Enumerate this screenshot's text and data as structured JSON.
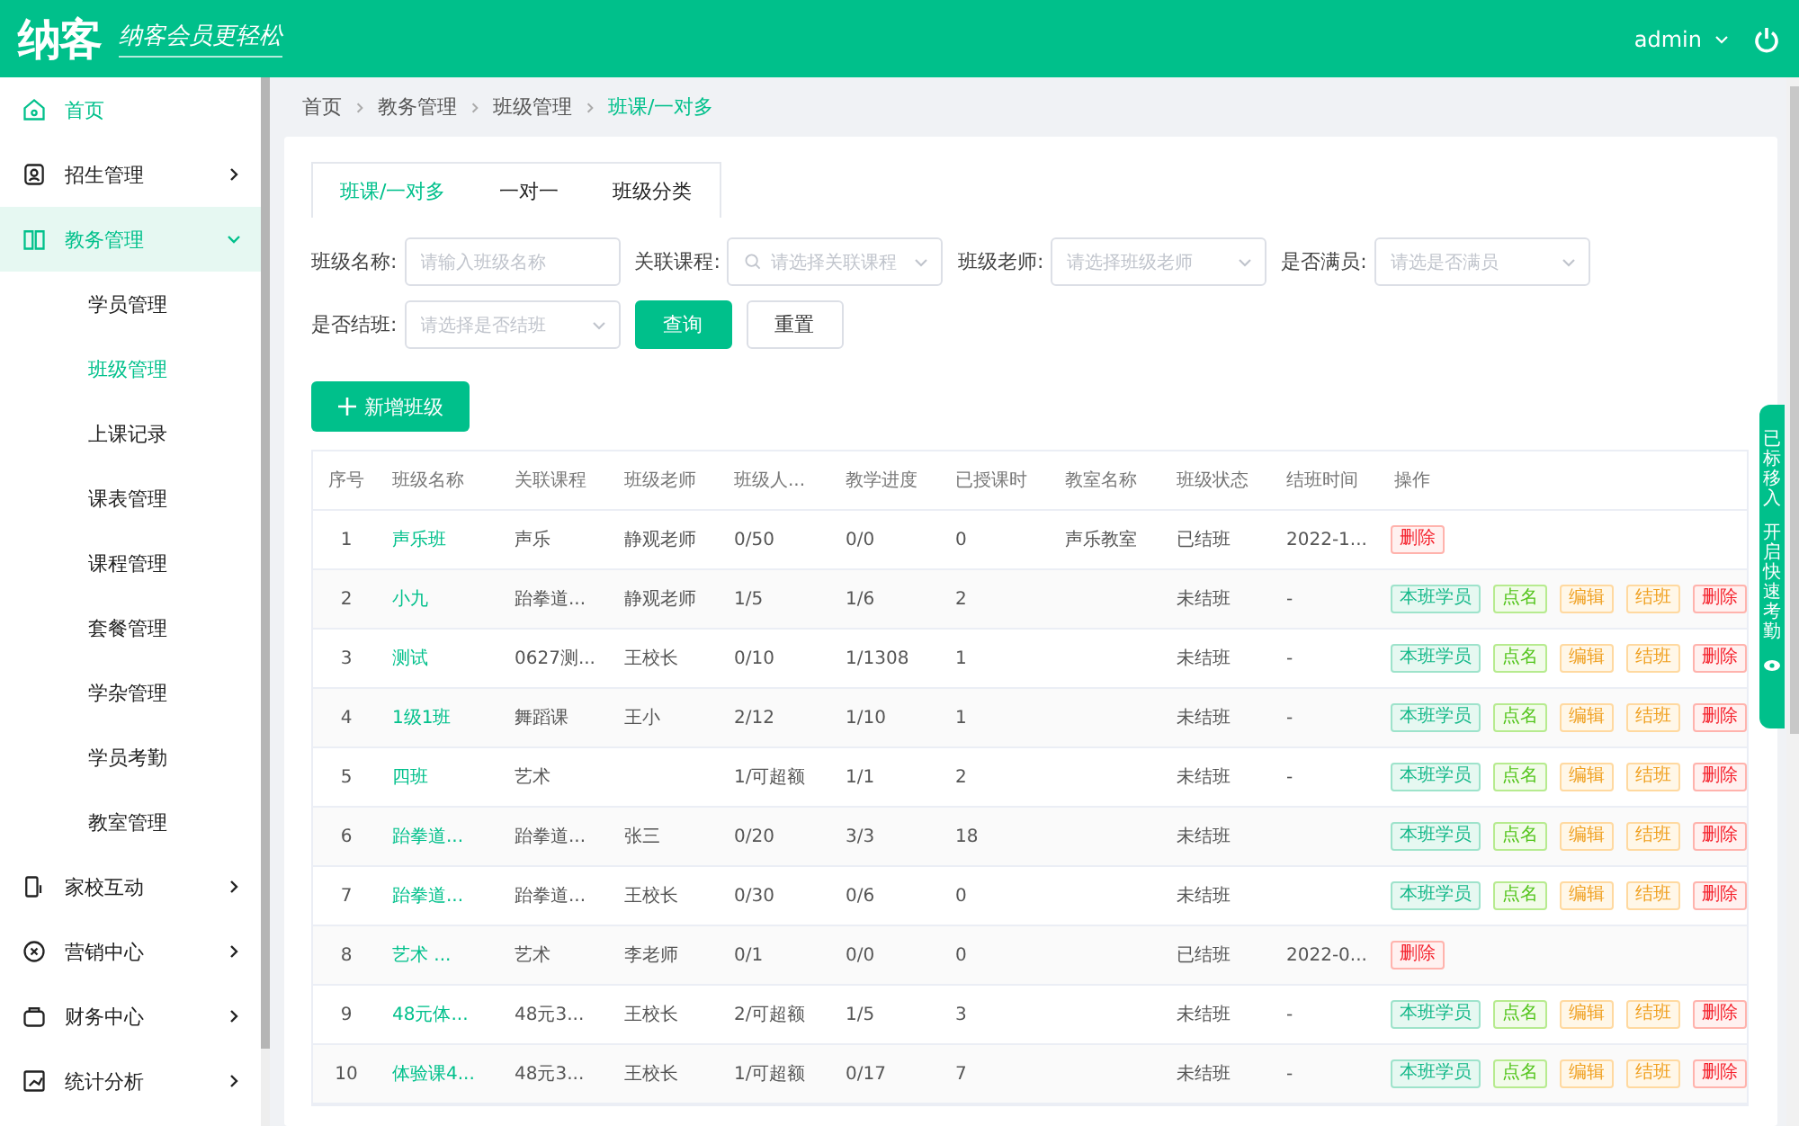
{
  "header": {
    "logo": "纳客",
    "slogan": "纳客会员更轻松",
    "user": "admin"
  },
  "sidebar": {
    "items": [
      {
        "label": "首页",
        "selected": true
      },
      {
        "label": "招生管理",
        "selected": false,
        "expanded": false
      },
      {
        "label": "教务管理",
        "selected": true,
        "expanded": true,
        "children": [
          {
            "label": "学员管理",
            "selected": false
          },
          {
            "label": "班级管理",
            "selected": true
          },
          {
            "label": "上课记录",
            "selected": false
          },
          {
            "label": "课表管理",
            "selected": false
          },
          {
            "label": "课程管理",
            "selected": false
          },
          {
            "label": "套餐管理",
            "selected": false
          },
          {
            "label": "学杂管理",
            "selected": false
          },
          {
            "label": "学员考勤",
            "selected": false
          },
          {
            "label": "教室管理",
            "selected": false
          }
        ]
      },
      {
        "label": "家校互动",
        "selected": false,
        "expanded": false
      },
      {
        "label": "营销中心",
        "selected": false,
        "expanded": false
      },
      {
        "label": "财务中心",
        "selected": false,
        "expanded": false
      },
      {
        "label": "统计分析",
        "selected": false,
        "expanded": false
      }
    ]
  },
  "breadcrumb": [
    {
      "label": "首页",
      "current": false
    },
    {
      "label": "教务管理",
      "current": false
    },
    {
      "label": "班级管理",
      "current": false
    },
    {
      "label": "班课/一对多",
      "current": true
    }
  ],
  "tabs": [
    {
      "label": "班课/一对多",
      "selected": true
    },
    {
      "label": "一对一",
      "selected": false
    },
    {
      "label": "班级分类",
      "selected": false
    }
  ],
  "filters": [
    {
      "label": "班级名称:",
      "placeholder": "请输入班级名称",
      "kind": "input"
    },
    {
      "label": "关联课程:",
      "placeholder": "请选择关联课程",
      "kind": "search-select"
    },
    {
      "label": "班级老师:",
      "placeholder": "请选择班级老师",
      "kind": "select"
    },
    {
      "label": "是否满员:",
      "placeholder": "请选是否满员",
      "kind": "select"
    },
    {
      "label": "是否结班:",
      "placeholder": "请选择是否结班",
      "kind": "select"
    }
  ],
  "query_button": "查询",
  "reset_button": "重置",
  "add_button": "新增班级",
  "table": {
    "columns": [
      {
        "label": "序号",
        "kind": "index"
      },
      {
        "label": "班级名称",
        "kind": "link"
      },
      {
        "label": "关联课程",
        "kind": "text"
      },
      {
        "label": "班级老师",
        "kind": "text"
      },
      {
        "label": "班级人...",
        "kind": "text"
      },
      {
        "label": "教学进度",
        "kind": "text"
      },
      {
        "label": "已授课时",
        "kind": "text"
      },
      {
        "label": "教室名称",
        "kind": "text"
      },
      {
        "label": "班级状态",
        "kind": "text"
      },
      {
        "label": "结班时间",
        "kind": "text"
      },
      {
        "label": "操作",
        "kind": "actions"
      }
    ],
    "rows": [
      {
        "cells": [
          "1",
          "声乐班",
          "声乐",
          "静观老师",
          "0/50",
          "0/0",
          "0",
          "声乐教室",
          "已结班",
          "2022-1..."
        ],
        "actions": [
          {
            "label": "删除",
            "kind": "danger"
          }
        ]
      },
      {
        "cells": [
          "2",
          "小九",
          "跆拳道...",
          "静观老师",
          "1/5",
          "1/6",
          "2",
          "",
          "未结班",
          "-"
        ],
        "actions": [
          {
            "label": "本班学员",
            "kind": "primary"
          },
          {
            "label": "点名",
            "kind": "success"
          },
          {
            "label": "编辑",
            "kind": "warning"
          },
          {
            "label": "结班",
            "kind": "warning"
          },
          {
            "label": "删除",
            "kind": "danger"
          }
        ]
      },
      {
        "cells": [
          "3",
          "测试",
          "0627测...",
          "王校长",
          "0/10",
          "1/1308",
          "1",
          "",
          "未结班",
          "-"
        ],
        "actions": [
          {
            "label": "本班学员",
            "kind": "primary"
          },
          {
            "label": "点名",
            "kind": "success"
          },
          {
            "label": "编辑",
            "kind": "warning"
          },
          {
            "label": "结班",
            "kind": "warning"
          },
          {
            "label": "删除",
            "kind": "danger"
          }
        ]
      },
      {
        "cells": [
          "4",
          "1级1班",
          "舞蹈课",
          "王小",
          "2/12",
          "1/10",
          "1",
          "",
          "未结班",
          "-"
        ],
        "actions": [
          {
            "label": "本班学员",
            "kind": "primary"
          },
          {
            "label": "点名",
            "kind": "success"
          },
          {
            "label": "编辑",
            "kind": "warning"
          },
          {
            "label": "结班",
            "kind": "warning"
          },
          {
            "label": "删除",
            "kind": "danger"
          }
        ]
      },
      {
        "cells": [
          "5",
          "四班",
          "艺术",
          "",
          "1/可超额",
          "1/1",
          "2",
          "",
          "未结班",
          "-"
        ],
        "actions": [
          {
            "label": "本班学员",
            "kind": "primary"
          },
          {
            "label": "点名",
            "kind": "success"
          },
          {
            "label": "编辑",
            "kind": "warning"
          },
          {
            "label": "结班",
            "kind": "warning"
          },
          {
            "label": "删除",
            "kind": "danger"
          }
        ]
      },
      {
        "cells": [
          "6",
          "跆拳道...",
          "跆拳道...",
          "张三",
          "0/20",
          "3/3",
          "18",
          "",
          "未结班",
          ""
        ],
        "actions": [
          {
            "label": "本班学员",
            "kind": "primary"
          },
          {
            "label": "点名",
            "kind": "success"
          },
          {
            "label": "编辑",
            "kind": "warning"
          },
          {
            "label": "结班",
            "kind": "warning"
          },
          {
            "label": "删除",
            "kind": "danger"
          }
        ]
      },
      {
        "cells": [
          "7",
          "跆拳道...",
          "跆拳道...",
          "王校长",
          "0/30",
          "0/6",
          "0",
          "",
          "未结班",
          ""
        ],
        "actions": [
          {
            "label": "本班学员",
            "kind": "primary"
          },
          {
            "label": "点名",
            "kind": "success"
          },
          {
            "label": "编辑",
            "kind": "warning"
          },
          {
            "label": "结班",
            "kind": "warning"
          },
          {
            "label": "删除",
            "kind": "danger"
          }
        ]
      },
      {
        "cells": [
          "8",
          "艺术 ...",
          "艺术",
          "李老师",
          "0/1",
          "0/0",
          "0",
          "",
          "已结班",
          "2022-0..."
        ],
        "actions": [
          {
            "label": "删除",
            "kind": "danger"
          }
        ]
      },
      {
        "cells": [
          "9",
          "48元体...",
          "48元3...",
          "王校长",
          "2/可超额",
          "1/5",
          "3",
          "",
          "未结班",
          "-"
        ],
        "actions": [
          {
            "label": "本班学员",
            "kind": "primary"
          },
          {
            "label": "点名",
            "kind": "success"
          },
          {
            "label": "编辑",
            "kind": "warning"
          },
          {
            "label": "结班",
            "kind": "warning"
          },
          {
            "label": "删除",
            "kind": "danger"
          }
        ]
      },
      {
        "cells": [
          "10",
          "体验课4...",
          "48元3...",
          "王校长",
          "1/可超额",
          "0/17",
          "7",
          "",
          "未结班",
          "-"
        ],
        "actions": [
          {
            "label": "本班学员",
            "kind": "primary"
          },
          {
            "label": "点名",
            "kind": "success"
          },
          {
            "label": "编辑",
            "kind": "warning"
          },
          {
            "label": "结班",
            "kind": "warning"
          },
          {
            "label": "删除",
            "kind": "danger"
          }
        ]
      }
    ]
  },
  "side_tab": {
    "lines": [
      "已标移入",
      "开启快速考勤"
    ]
  }
}
